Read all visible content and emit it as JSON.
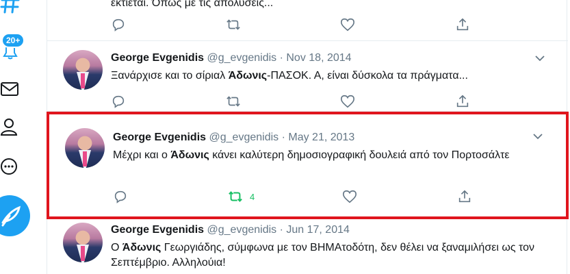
{
  "nav": {
    "notifications_badge": "20+"
  },
  "colors": {
    "accent": "#1da1f2",
    "retweet_active": "#17bf63",
    "highlight_border": "#e0151d",
    "muted": "#657786"
  },
  "tweets": [
    {
      "text": "εκτίεται. Όπως με τις απολύσεις..."
    },
    {
      "name": "George Evgenidis",
      "handle": "@g_evgenidis",
      "separator": "·",
      "date": "Nov 18, 2014",
      "text_before": "Ξανάρχισε και το σίριαλ ",
      "text_bold": "Άδωνις",
      "text_after": "-ΠΑΣΟΚ. Α, είναι δύσκολα τα πράγματα..."
    },
    {
      "name": "George Evgenidis",
      "handle": "@g_evgenidis",
      "separator": "·",
      "date": "May 21, 2013",
      "text_before": "Μέχρι και ο ",
      "text_bold": "Άδωνις",
      "text_after": " κάνει καλύτερη δημοσιογραφική δουλειά από τον Πορτοσάλτε",
      "retweet_count": "4",
      "highlighted": true
    },
    {
      "name": "George Evgenidis",
      "handle": "@g_evgenidis",
      "separator": "·",
      "date": "Jun 17, 2014",
      "text_before": "Ο ",
      "text_bold": "Άδωνις",
      "text_after": " Γεωργιάδης, σύμφωνα με τον ΒΗΜΑτοδότη, δεν θέλει να ξαναμιλήσει ως τον Σεπτέμβριο. Αλληλούια!"
    }
  ],
  "icons": [
    "hashtag-icon",
    "bell-icon",
    "mail-icon",
    "profile-icon",
    "more-icon",
    "compose-icon",
    "reply-icon",
    "retweet-icon",
    "like-icon",
    "share-icon",
    "chevron-down-icon"
  ]
}
